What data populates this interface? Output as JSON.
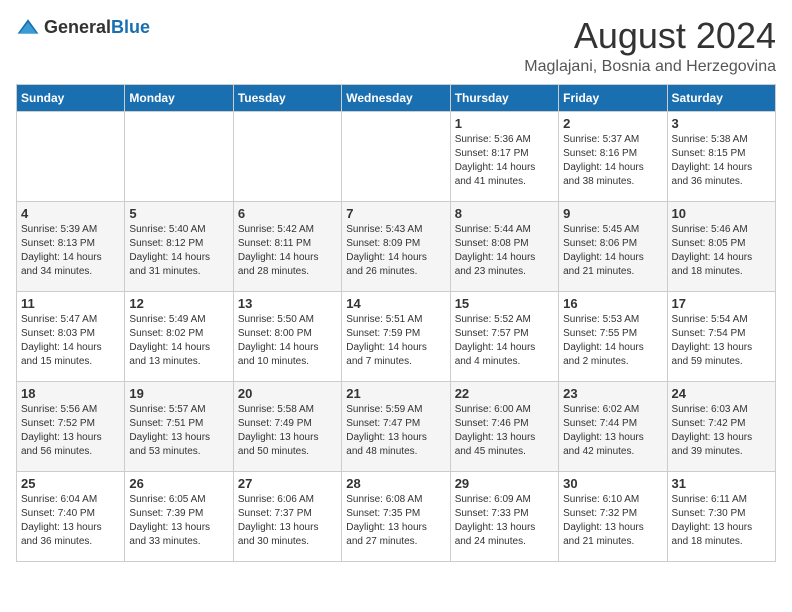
{
  "logo": {
    "text_general": "General",
    "text_blue": "Blue"
  },
  "header": {
    "month_year": "August 2024",
    "location": "Maglajani, Bosnia and Herzegovina"
  },
  "weekdays": [
    "Sunday",
    "Monday",
    "Tuesday",
    "Wednesday",
    "Thursday",
    "Friday",
    "Saturday"
  ],
  "weeks": [
    [
      {
        "day": "",
        "info": ""
      },
      {
        "day": "",
        "info": ""
      },
      {
        "day": "",
        "info": ""
      },
      {
        "day": "",
        "info": ""
      },
      {
        "day": "1",
        "sunrise": "5:36 AM",
        "sunset": "8:17 PM",
        "daylight": "14 hours and 41 minutes."
      },
      {
        "day": "2",
        "sunrise": "5:37 AM",
        "sunset": "8:16 PM",
        "daylight": "14 hours and 38 minutes."
      },
      {
        "day": "3",
        "sunrise": "5:38 AM",
        "sunset": "8:15 PM",
        "daylight": "14 hours and 36 minutes."
      }
    ],
    [
      {
        "day": "4",
        "sunrise": "5:39 AM",
        "sunset": "8:13 PM",
        "daylight": "14 hours and 34 minutes."
      },
      {
        "day": "5",
        "sunrise": "5:40 AM",
        "sunset": "8:12 PM",
        "daylight": "14 hours and 31 minutes."
      },
      {
        "day": "6",
        "sunrise": "5:42 AM",
        "sunset": "8:11 PM",
        "daylight": "14 hours and 28 minutes."
      },
      {
        "day": "7",
        "sunrise": "5:43 AM",
        "sunset": "8:09 PM",
        "daylight": "14 hours and 26 minutes."
      },
      {
        "day": "8",
        "sunrise": "5:44 AM",
        "sunset": "8:08 PM",
        "daylight": "14 hours and 23 minutes."
      },
      {
        "day": "9",
        "sunrise": "5:45 AM",
        "sunset": "8:06 PM",
        "daylight": "14 hours and 21 minutes."
      },
      {
        "day": "10",
        "sunrise": "5:46 AM",
        "sunset": "8:05 PM",
        "daylight": "14 hours and 18 minutes."
      }
    ],
    [
      {
        "day": "11",
        "sunrise": "5:47 AM",
        "sunset": "8:03 PM",
        "daylight": "14 hours and 15 minutes."
      },
      {
        "day": "12",
        "sunrise": "5:49 AM",
        "sunset": "8:02 PM",
        "daylight": "14 hours and 13 minutes."
      },
      {
        "day": "13",
        "sunrise": "5:50 AM",
        "sunset": "8:00 PM",
        "daylight": "14 hours and 10 minutes."
      },
      {
        "day": "14",
        "sunrise": "5:51 AM",
        "sunset": "7:59 PM",
        "daylight": "14 hours and 7 minutes."
      },
      {
        "day": "15",
        "sunrise": "5:52 AM",
        "sunset": "7:57 PM",
        "daylight": "14 hours and 4 minutes."
      },
      {
        "day": "16",
        "sunrise": "5:53 AM",
        "sunset": "7:55 PM",
        "daylight": "14 hours and 2 minutes."
      },
      {
        "day": "17",
        "sunrise": "5:54 AM",
        "sunset": "7:54 PM",
        "daylight": "13 hours and 59 minutes."
      }
    ],
    [
      {
        "day": "18",
        "sunrise": "5:56 AM",
        "sunset": "7:52 PM",
        "daylight": "13 hours and 56 minutes."
      },
      {
        "day": "19",
        "sunrise": "5:57 AM",
        "sunset": "7:51 PM",
        "daylight": "13 hours and 53 minutes."
      },
      {
        "day": "20",
        "sunrise": "5:58 AM",
        "sunset": "7:49 PM",
        "daylight": "13 hours and 50 minutes."
      },
      {
        "day": "21",
        "sunrise": "5:59 AM",
        "sunset": "7:47 PM",
        "daylight": "13 hours and 48 minutes."
      },
      {
        "day": "22",
        "sunrise": "6:00 AM",
        "sunset": "7:46 PM",
        "daylight": "13 hours and 45 minutes."
      },
      {
        "day": "23",
        "sunrise": "6:02 AM",
        "sunset": "7:44 PM",
        "daylight": "13 hours and 42 minutes."
      },
      {
        "day": "24",
        "sunrise": "6:03 AM",
        "sunset": "7:42 PM",
        "daylight": "13 hours and 39 minutes."
      }
    ],
    [
      {
        "day": "25",
        "sunrise": "6:04 AM",
        "sunset": "7:40 PM",
        "daylight": "13 hours and 36 minutes."
      },
      {
        "day": "26",
        "sunrise": "6:05 AM",
        "sunset": "7:39 PM",
        "daylight": "13 hours and 33 minutes."
      },
      {
        "day": "27",
        "sunrise": "6:06 AM",
        "sunset": "7:37 PM",
        "daylight": "13 hours and 30 minutes."
      },
      {
        "day": "28",
        "sunrise": "6:08 AM",
        "sunset": "7:35 PM",
        "daylight": "13 hours and 27 minutes."
      },
      {
        "day": "29",
        "sunrise": "6:09 AM",
        "sunset": "7:33 PM",
        "daylight": "13 hours and 24 minutes."
      },
      {
        "day": "30",
        "sunrise": "6:10 AM",
        "sunset": "7:32 PM",
        "daylight": "13 hours and 21 minutes."
      },
      {
        "day": "31",
        "sunrise": "6:11 AM",
        "sunset": "7:30 PM",
        "daylight": "13 hours and 18 minutes."
      }
    ]
  ]
}
